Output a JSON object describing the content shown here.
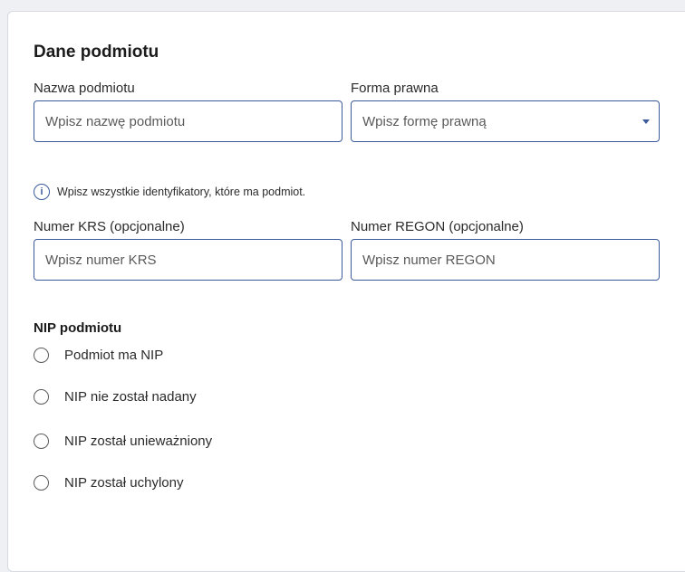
{
  "section_title": "Dane podmiotu",
  "nazwa": {
    "label": "Nazwa podmiotu",
    "placeholder": "Wpisz nazwę podmiotu"
  },
  "forma": {
    "label": "Forma prawna",
    "placeholder": "Wpisz formę prawną"
  },
  "info_text": "Wpisz wszystkie identyfikatory, które ma podmiot.",
  "info_icon_glyph": "i",
  "krs": {
    "label": "Numer KRS (opcjonalne)",
    "placeholder": "Wpisz numer KRS"
  },
  "regon": {
    "label": "Numer REGON (opcjonalne)",
    "placeholder": "Wpisz numer REGON"
  },
  "nip": {
    "heading": "NIP podmiotu",
    "options": [
      "Podmiot ma NIP",
      "NIP nie został nadany",
      "NIP został unieważniony",
      "NIP został uchylony"
    ]
  },
  "colors": {
    "accent": "#3c5a9a",
    "border": "#d6dae0",
    "background": "#eef0f3"
  }
}
